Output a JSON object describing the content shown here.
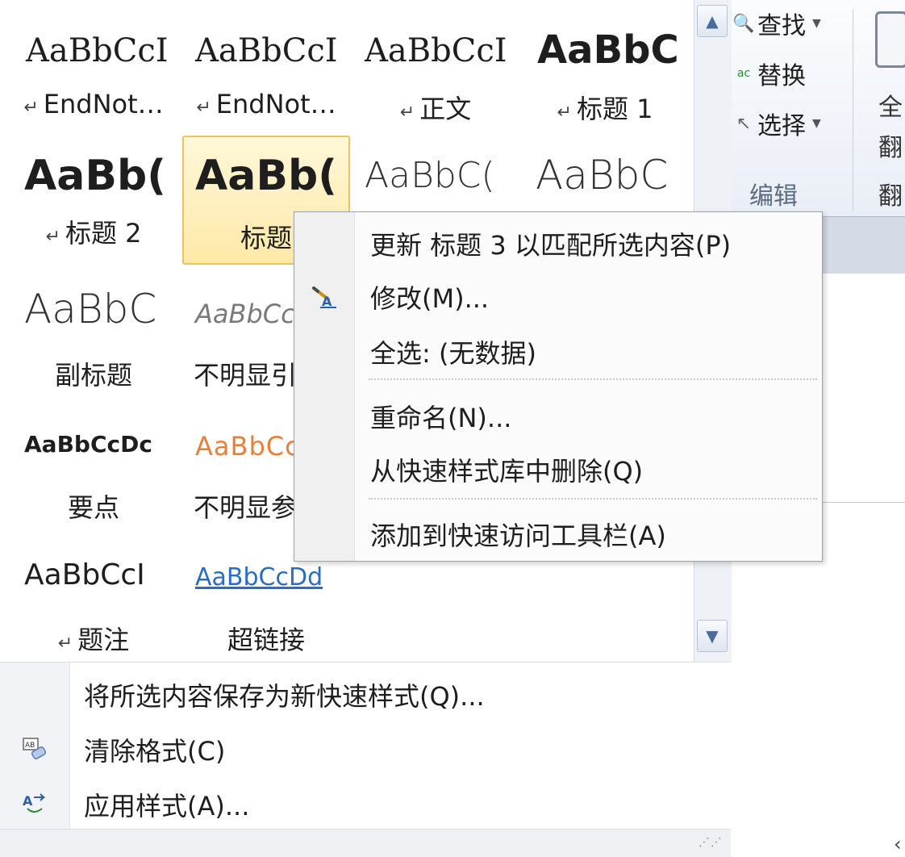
{
  "ribbon": {
    "find_label": "查找",
    "replace_label": "替换",
    "select_label": "选择",
    "group_label": "编辑",
    "clip_chars": [
      "全",
      "翻",
      "翻"
    ]
  },
  "gallery": {
    "styles": [
      {
        "preview": "AaBbCcI",
        "name": "EndNot…",
        "para_mark": true
      },
      {
        "preview": "AaBbCcI",
        "name": "EndNot…",
        "para_mark": true
      },
      {
        "preview": "AaBbCcI",
        "name": "正文",
        "para_mark": true
      },
      {
        "preview": "AaBbC",
        "name": "标题 1",
        "para_mark": true
      },
      {
        "preview": "AaBb(",
        "name": "标题 2",
        "para_mark": true
      },
      {
        "preview": "AaBb(",
        "name": "标题",
        "para_mark": false,
        "selected": true
      },
      {
        "preview": "AaBbC(",
        "name": "",
        "para_mark": false
      },
      {
        "preview": "AaBbC",
        "name": "",
        "para_mark": false
      },
      {
        "preview": "AaBbC",
        "name": "副标题",
        "para_mark": false
      },
      {
        "preview": "AaBbCc",
        "name": "不明显引",
        "para_mark": false
      },
      {
        "preview": "AaBbCcDc",
        "name": "要点",
        "para_mark": false
      },
      {
        "preview": "AaBbCc",
        "name": "不明显参",
        "para_mark": false
      },
      {
        "preview": "AaBbCcI",
        "name": "题注",
        "para_mark": true
      },
      {
        "preview": "AaBbCcDd",
        "name": "超链接",
        "para_mark": false
      }
    ],
    "para_glyph": "↵"
  },
  "bottom_menu": {
    "save_new": "将所选内容保存为新快速样式(Q)...",
    "clear_format": "清除格式(C)",
    "apply_styles": "应用样式(A)..."
  },
  "context_menu": {
    "update": "更新 标题 3 以匹配所选内容(P)",
    "modify": "修改(M)...",
    "select_all": "全选: (无数据)",
    "rename": "重命名(N)...",
    "remove_gallery": "从快速样式库中删除(Q)",
    "add_qat": "添加到快速访问工具栏(A)"
  },
  "colors": {
    "selection_border": "#f0c35a",
    "link_blue": "#2b6cc4",
    "orange": "#e8803a",
    "icon_blue": "#2d5ea8"
  }
}
